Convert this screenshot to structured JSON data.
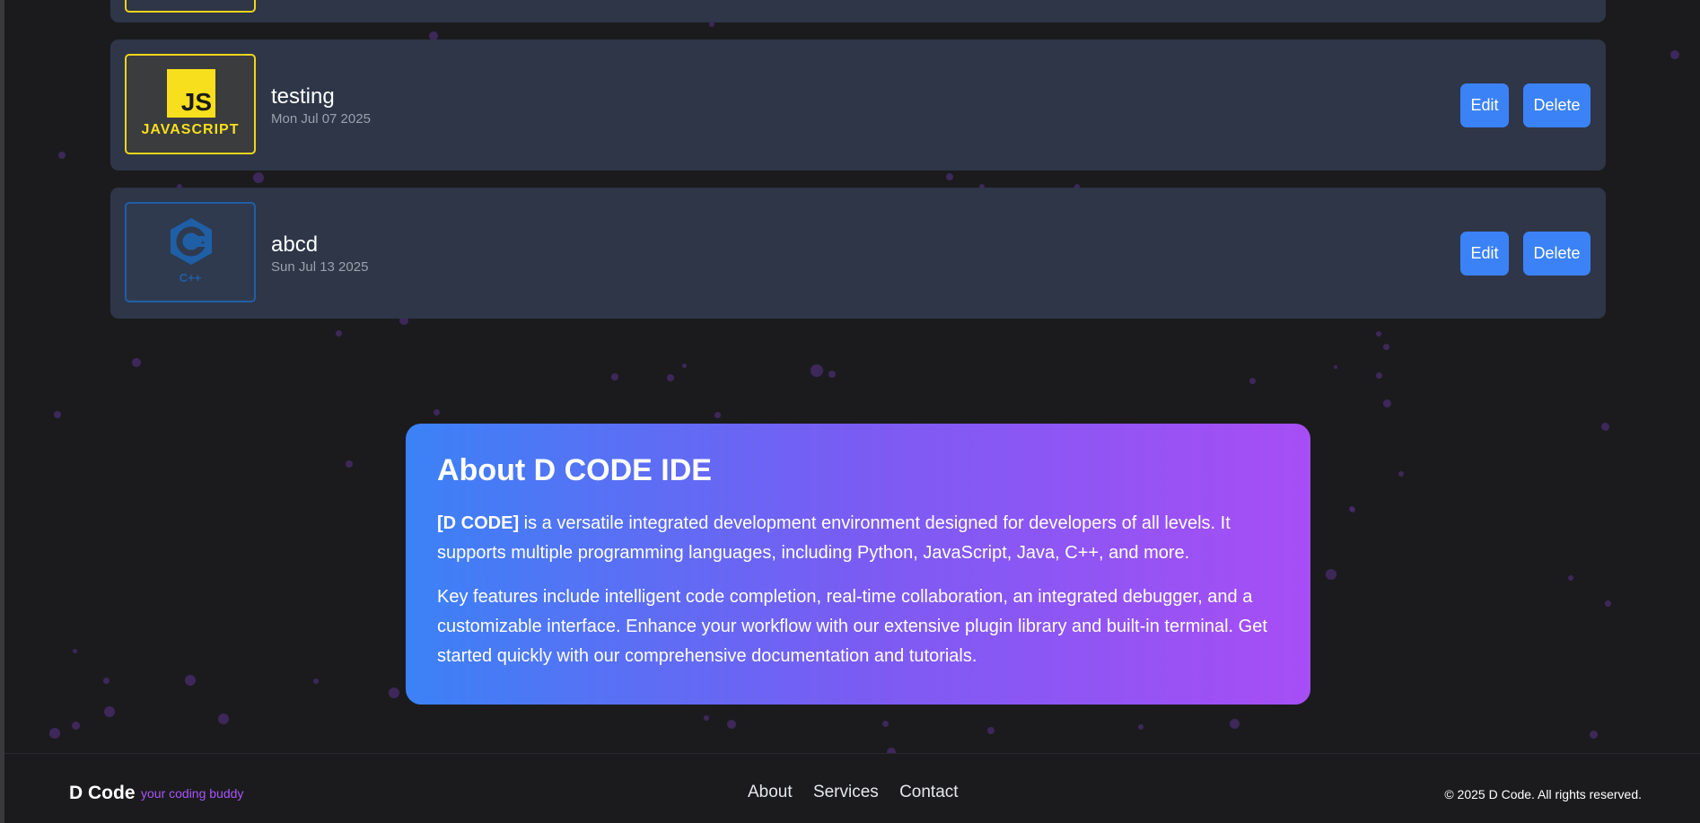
{
  "projects": [
    {
      "name": "testing",
      "date": "Mon Jul 07 2025",
      "language_logo": "javascript-logo",
      "logo_text": "JS",
      "logo_label": "JAVASCRIPT",
      "accent_color": "#f7df1e",
      "edit_label": "Edit",
      "delete_label": "Delete"
    },
    {
      "name": "abcd",
      "date": "Sun Jul 13 2025",
      "language_logo": "cpp-logo",
      "logo_text": "C",
      "logo_label": "C++",
      "accent_color": "#1f5fa6",
      "edit_label": "Edit",
      "delete_label": "Delete"
    }
  ],
  "about": {
    "title": "About D CODE IDE",
    "brand_bold": "[D CODE]",
    "paragraph1_rest": " is a versatile integrated development environment designed for developers of all levels. It supports multiple programming languages, including Python, JavaScript, Java, C++, and more.",
    "paragraph2": "Key features include intelligent code completion, real-time collaboration, an integrated debugger, and a customizable interface. Enhance your workflow with our extensive plugin library and built-in terminal. Get started quickly with our comprehensive documentation and tutorials.",
    "gradient_start": "#3b82f6",
    "gradient_end": "#a855f7"
  },
  "footer": {
    "brand": "D Code",
    "tagline": "your coding buddy",
    "links": [
      "About",
      "Services",
      "Contact"
    ],
    "copyright": "© 2025 D Code. All rights reserved."
  },
  "colors": {
    "background": "#1b1b1e",
    "card": "#2e3648",
    "button": "#3b82f6",
    "tagline": "#a855f7"
  }
}
